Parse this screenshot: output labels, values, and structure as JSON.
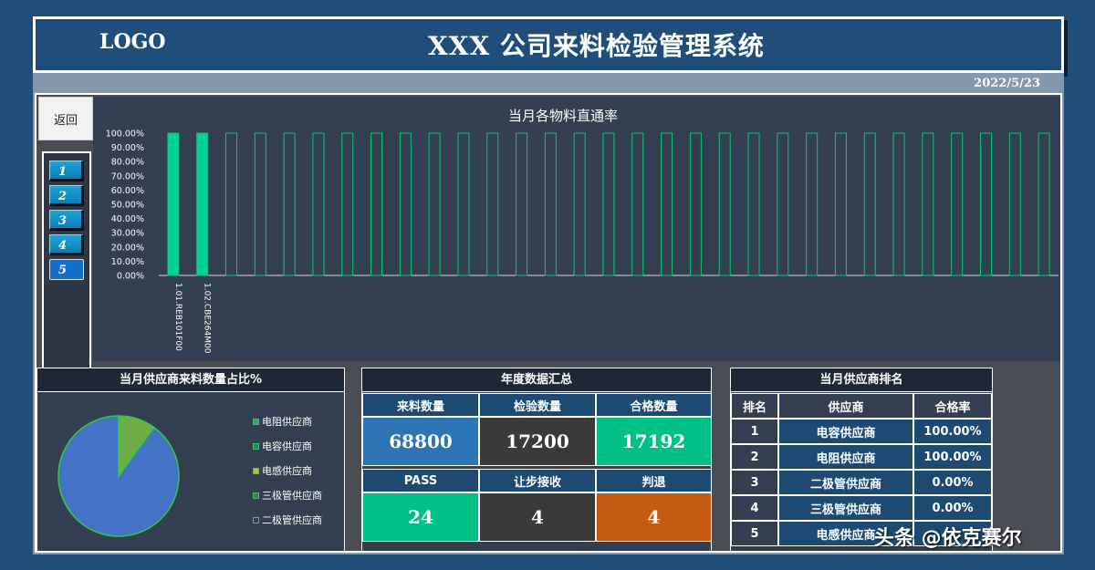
{
  "header": {
    "logo": "LOGO",
    "title": "XXX 公司来料检验管理系统",
    "date": "2022/5/23"
  },
  "nav": {
    "back_label": "返回",
    "items": [
      "1",
      "2",
      "3",
      "4",
      "5"
    ],
    "active_index": 4
  },
  "chart_data": {
    "type": "bar",
    "title": "当月各物料直通率",
    "categories": [
      "1.01.REB101F00",
      "1.02.CBE264M00",
      "",
      "",
      "",
      "",
      "",
      "",
      "",
      "",
      "",
      "",
      "",
      "",
      "",
      "",
      "",
      "",
      "",
      "",
      "",
      "",
      "",
      "",
      "",
      "",
      "",
      "",
      "",
      "",
      ""
    ],
    "values": [
      100,
      100,
      0,
      0,
      0,
      0,
      0,
      0,
      0,
      0,
      0,
      0,
      0,
      0,
      0,
      0,
      0,
      0,
      0,
      0,
      0,
      0,
      0,
      0,
      0,
      0,
      0,
      0,
      0,
      0,
      0
    ],
    "ylim": [
      0,
      100
    ],
    "yticks": [
      "100.00%",
      "90.00%",
      "80.00%",
      "70.00%",
      "60.00%",
      "50.00%",
      "40.00%",
      "30.00%",
      "20.00%",
      "10.00%",
      "0.00%"
    ],
    "bar_color": "#00d095",
    "outline_color": "#00c87a"
  },
  "pie": {
    "title": "当月供应商来料数量占比%",
    "slices": [
      {
        "name": "电阻供应商",
        "value": 10,
        "color": "#70ad47"
      },
      {
        "name": "电容供应商",
        "value": 90,
        "color": "#4472c4"
      }
    ],
    "legend": [
      "电阻供应商",
      "电容供应商",
      "电感供应商",
      "三极管供应商",
      "二极管供应商"
    ],
    "legend_colors": [
      "#27ae60",
      "#1a8f4a",
      "#9acd32",
      "#2e8b57",
      "#333f50"
    ]
  },
  "summary": {
    "title": "年度数据汇总",
    "headers": [
      "来料数量",
      "检验数量",
      "合格数量"
    ],
    "values": [
      "68800",
      "17200",
      "17192"
    ],
    "headers2": [
      "PASS",
      "让步接收",
      "判退"
    ],
    "values2": [
      "24",
      "4",
      "4"
    ],
    "colors": [
      "#2e75b6",
      "#3a3a3a",
      "#00c087"
    ],
    "colors2": [
      "#00c087",
      "#3a3a3a",
      "#c55a11"
    ]
  },
  "ranking": {
    "title": "当月供应商排名",
    "headers": [
      "排名",
      "供应商",
      "合格率"
    ],
    "rows": [
      [
        "1",
        "电容供应商",
        "100.00%"
      ],
      [
        "2",
        "电阻供应商",
        "100.00%"
      ],
      [
        "3",
        "二极管供应商",
        "0.00%"
      ],
      [
        "4",
        "三极管供应商",
        "0.00%"
      ],
      [
        "5",
        "电感供应商",
        ""
      ]
    ]
  },
  "watermark": "头条 @依克赛尔"
}
